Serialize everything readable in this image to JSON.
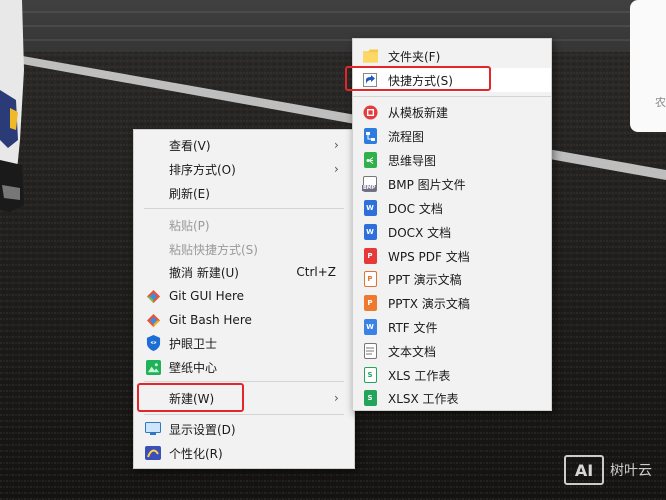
{
  "desktop": {
    "side_panel_text": "农"
  },
  "context_menu": {
    "items": [
      {
        "label": "查看(V)"
      },
      {
        "label": "排序方式(O)"
      },
      {
        "label": "刷新(E)"
      },
      {
        "label": "粘贴(P)"
      },
      {
        "label": "粘贴快捷方式(S)"
      },
      {
        "label": "撤消 新建(U)",
        "shortcut": "Ctrl+Z"
      },
      {
        "label": "Git GUI Here"
      },
      {
        "label": "Git Bash Here"
      },
      {
        "label": "护眼卫士"
      },
      {
        "label": "壁纸中心"
      },
      {
        "label": "新建(W)"
      },
      {
        "label": "显示设置(D)"
      },
      {
        "label": "个性化(R)"
      }
    ]
  },
  "new_submenu": {
    "items": [
      {
        "label": "文件夹(F)"
      },
      {
        "label": "快捷方式(S)"
      },
      {
        "label": "从模板新建"
      },
      {
        "label": "流程图"
      },
      {
        "label": "思维导图"
      },
      {
        "label": "BMP 图片文件"
      },
      {
        "label": "DOC 文档"
      },
      {
        "label": "DOCX 文档"
      },
      {
        "label": "WPS PDF 文档"
      },
      {
        "label": "PPT 演示文稿"
      },
      {
        "label": "PPTX 演示文稿"
      },
      {
        "label": "RTF 文件"
      },
      {
        "label": "文本文档"
      },
      {
        "label": "XLS 工作表"
      },
      {
        "label": "XLSX 工作表"
      }
    ]
  },
  "watermark": {
    "logo": "AI",
    "text": "树叶云"
  },
  "colors": {
    "highlight": "#e4262b",
    "menu_bg": "#f2f2f2"
  }
}
